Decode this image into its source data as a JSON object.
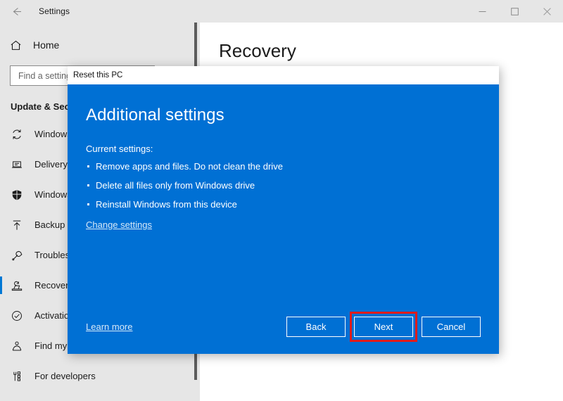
{
  "window": {
    "title": "Settings",
    "back_icon": "back-arrow-icon",
    "controls": {
      "minimize": "─",
      "maximize": "□",
      "close": "✕"
    }
  },
  "sidebar": {
    "home_label": "Home",
    "home_icon": "home-icon",
    "search": {
      "placeholder": "Find a setting",
      "value": ""
    },
    "section_title": "Update & Security",
    "items": [
      {
        "label": "Windows Update",
        "icon": "sync-refresh-icon",
        "selected": false
      },
      {
        "label": "Delivery Optimization",
        "icon": "laptop-delivery-icon",
        "selected": false
      },
      {
        "label": "Windows Security",
        "icon": "shield-icon",
        "selected": false
      },
      {
        "label": "Backup",
        "icon": "upload-arrow-icon",
        "selected": false
      },
      {
        "label": "Troubleshoot",
        "icon": "wrench-icon",
        "selected": false
      },
      {
        "label": "Recovery",
        "icon": "recovery-icon",
        "selected": true
      },
      {
        "label": "Activation",
        "icon": "check-circle-icon",
        "selected": false
      },
      {
        "label": "Find my device",
        "icon": "locate-person-icon",
        "selected": false
      },
      {
        "label": "For developers",
        "icon": "developer-tools-icon",
        "selected": false
      }
    ]
  },
  "content": {
    "page_title": "Recovery"
  },
  "dialog": {
    "titlebar_text": "Reset this PC",
    "heading": "Additional settings",
    "current_settings_label": "Current settings:",
    "bullets": [
      "Remove apps and files. Do not clean the drive",
      "Delete all files only from Windows drive",
      "Reinstall Windows from this device"
    ],
    "change_settings_link": "Change settings",
    "learn_more_link": "Learn more",
    "buttons": {
      "back": "Back",
      "next": "Next",
      "cancel": "Cancel"
    },
    "highlighted_button": "Next"
  },
  "colors": {
    "dialog_blue": "#0070d4",
    "accent_blue": "#0078d4",
    "highlight_red": "#e01b1b",
    "sidebar_gray": "#e6e6e6"
  }
}
